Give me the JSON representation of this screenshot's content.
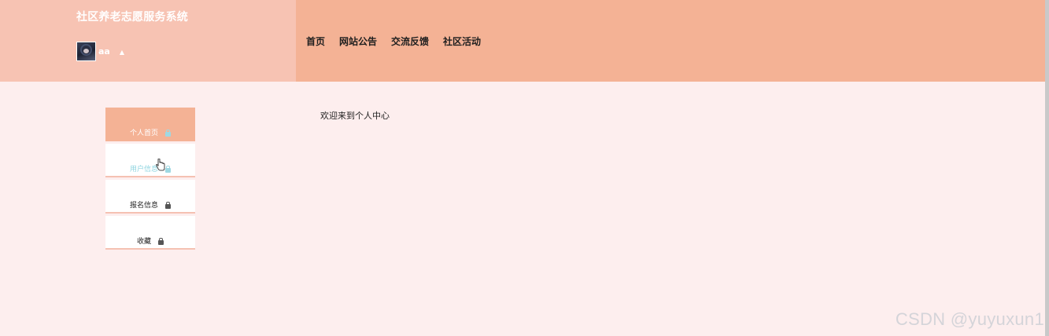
{
  "app": {
    "title": "社区养老志愿服务系统"
  },
  "user": {
    "name": "aa",
    "caret_icon": "caret-up-icon"
  },
  "nav": {
    "items": [
      {
        "label": "首页"
      },
      {
        "label": "网站公告"
      },
      {
        "label": "交流反馈"
      },
      {
        "label": "社区活动"
      }
    ]
  },
  "sidebar": {
    "items": [
      {
        "label": "个人首页",
        "icon": "lock-icon",
        "state": "active"
      },
      {
        "label": "用户信息",
        "icon": "lock-icon",
        "state": "hover"
      },
      {
        "label": "报名信息",
        "icon": "lock-icon",
        "state": "normal"
      },
      {
        "label": "收藏",
        "icon": "lock-icon",
        "state": "normal"
      }
    ]
  },
  "main": {
    "welcome_text": "欢迎来到个人中心"
  },
  "watermark": {
    "text": "CSDN @yuyuxun1"
  },
  "colors": {
    "brand_bg": "#f7c3b3",
    "nav_bg": "#f4b295",
    "page_bg": "#fdeeee",
    "hover_text": "#8fd5e0"
  }
}
